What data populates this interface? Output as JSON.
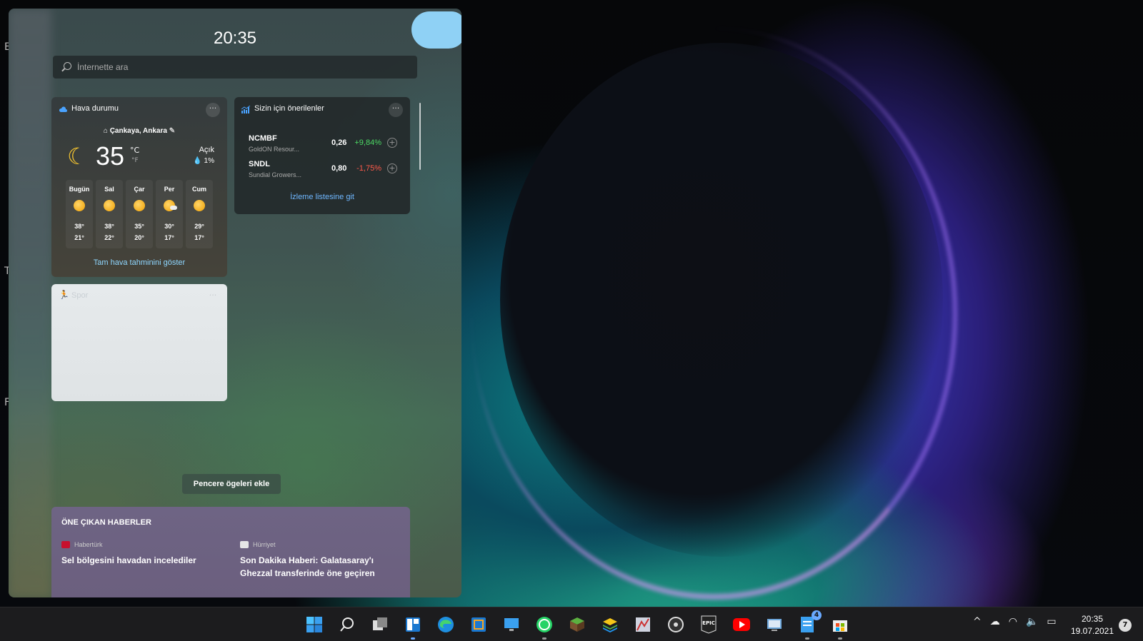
{
  "panel": {
    "clock": "20:35",
    "search": {
      "placeholder": "İnternette ara"
    }
  },
  "weather": {
    "title": "Hava durumu",
    "location": "Çankaya, Ankara",
    "temperature": "35",
    "unit_c": "°C",
    "unit_f": "°F",
    "condition": "Açık",
    "precipitation": "1%",
    "forecast": [
      {
        "day": "Bugün",
        "high": "38°",
        "low": "21°",
        "icon": "sun-icon"
      },
      {
        "day": "Sal",
        "high": "38°",
        "low": "22°",
        "icon": "sun-icon"
      },
      {
        "day": "Çar",
        "high": "35°",
        "low": "20°",
        "icon": "sun-icon"
      },
      {
        "day": "Per",
        "high": "30°",
        "low": "17°",
        "icon": "partly-cloudy-icon"
      },
      {
        "day": "Cum",
        "high": "29°",
        "low": "17°",
        "icon": "sun-icon"
      }
    ],
    "link": "Tam hava tahminini göster"
  },
  "stocks": {
    "title": "Sizin için önerilenler",
    "rows": [
      {
        "symbol": "NCMBF",
        "name": "GoldON Resour...",
        "price": "0,26",
        "change": "+9,84%",
        "color": "#4cd964"
      },
      {
        "symbol": "SNDL",
        "name": "Sundial Growers...",
        "price": "0,80",
        "change": "-1,75%",
        "color": "#ff5a4a"
      }
    ],
    "link": "İzleme listesine git"
  },
  "sports": {
    "title": "Spor"
  },
  "add_widgets": "Pencere ögeleri ekle",
  "news": {
    "heading": "ÖNE ÇIKAN HABERLER",
    "items": [
      {
        "source": "Habertürk",
        "headline": "Sel bölgesini havadan incelediler"
      },
      {
        "source": "Hürriyet",
        "headline": "Son Dakika Haberi: Galatasaray'ı Ghezzal transferinde öne geçiren"
      }
    ]
  },
  "taskbar": {
    "time": "20:35",
    "date": "19.07.2021",
    "notifications": "7",
    "badge_count": "4"
  },
  "desktop": {
    "labels": [
      "E",
      "T",
      "F"
    ]
  }
}
